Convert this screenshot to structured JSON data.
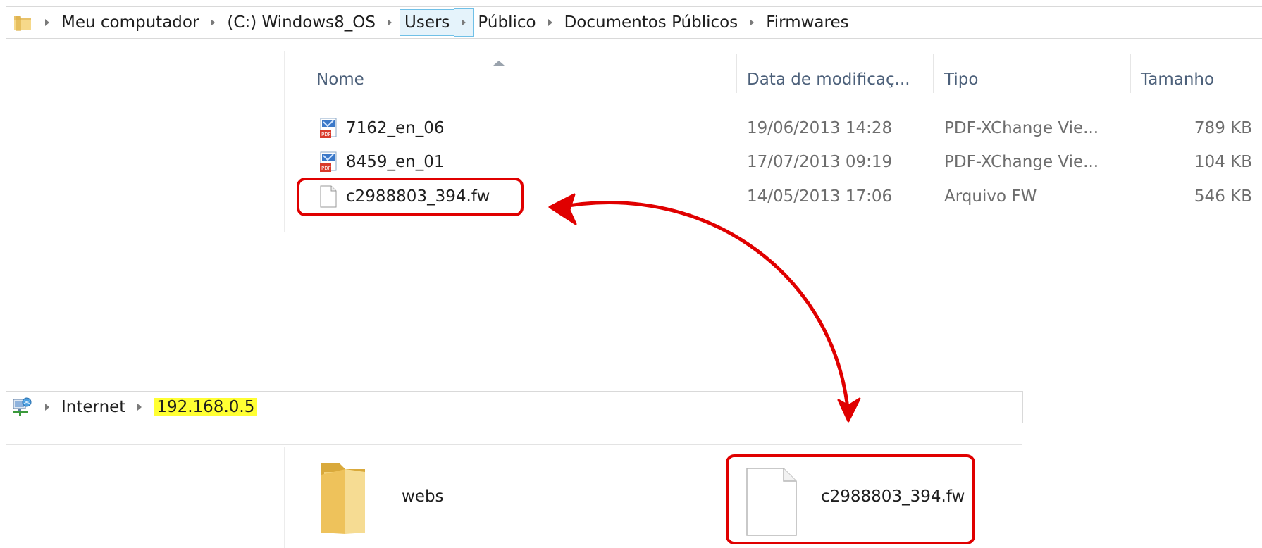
{
  "window_top": {
    "breadcrumb": [
      "Meu computador",
      "(C:) Windows8_OS",
      "Users",
      "Público",
      "Documentos Públicos",
      "Firmwares"
    ],
    "highlighted_crumb": "Users",
    "columns": {
      "name": "Nome",
      "date": "Data de modificaç...",
      "type": "Tipo",
      "size": "Tamanho"
    },
    "sort_column": "Nome",
    "files": [
      {
        "name": "7162_en_06",
        "date": "19/06/2013 14:28",
        "type": "PDF-XChange Vie...",
        "size": "789 KB",
        "icon": "pdf-file-icon"
      },
      {
        "name": "8459_en_01",
        "date": "17/07/2013 09:19",
        "type": "PDF-XChange Vie...",
        "size": "104 KB",
        "icon": "pdf-file-icon"
      },
      {
        "name": "c2988803_394.fw",
        "date": "14/05/2013 17:06",
        "type": "Arquivo FW",
        "size": "546 KB",
        "icon": "generic-file-icon"
      }
    ]
  },
  "window_bottom": {
    "breadcrumb": [
      "Internet",
      "192.168.0.5"
    ],
    "highlighted_crumb": "192.168.0.5",
    "items": [
      {
        "name": "webs",
        "icon": "folder-icon"
      },
      {
        "name": "c2988803_394.fw",
        "icon": "generic-file-icon"
      }
    ]
  },
  "annotation": {
    "color": "#e00000",
    "meaning": "double-headed arrow linking the same file in both locations"
  }
}
